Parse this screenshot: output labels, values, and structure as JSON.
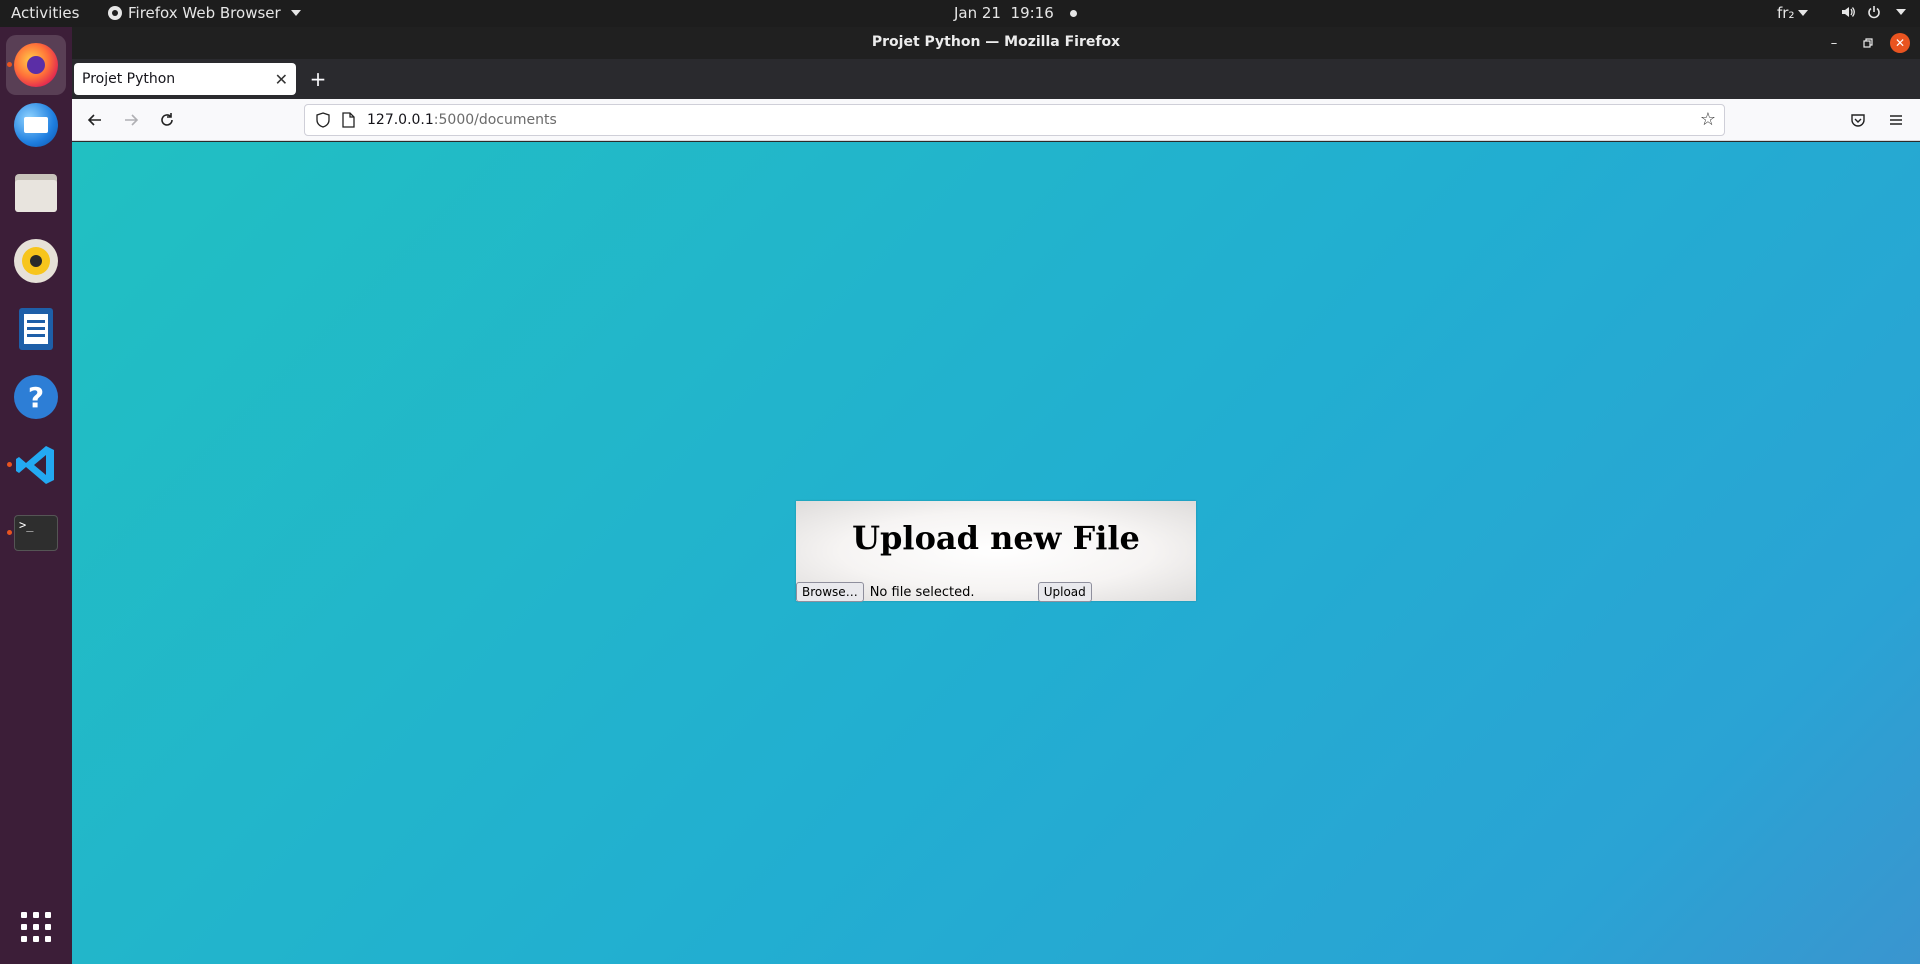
{
  "topbar": {
    "activities": "Activities",
    "app_name": "Firefox Web Browser",
    "date": "Jan 21",
    "time": "19:16",
    "keyboard_layout": "fr₂"
  },
  "dock": {
    "items": [
      {
        "name": "Firefox",
        "icon": "firefox-icon",
        "running": true,
        "active": true
      },
      {
        "name": "Thunderbird",
        "icon": "thunderbird-icon",
        "running": false
      },
      {
        "name": "Files",
        "icon": "files-icon",
        "running": false
      },
      {
        "name": "Rhythmbox",
        "icon": "rhythmbox-icon",
        "running": false
      },
      {
        "name": "LibreOffice Writer",
        "icon": "writer-icon",
        "running": false
      },
      {
        "name": "Help",
        "icon": "help-icon",
        "running": false,
        "glyph": "?"
      },
      {
        "name": "Visual Studio Code",
        "icon": "vscode-icon",
        "running": true
      },
      {
        "name": "Terminal",
        "icon": "terminal-icon",
        "running": true,
        "glyph": ">_"
      }
    ]
  },
  "window": {
    "title": "Projet Python — Mozilla Firefox",
    "tab_title": "Projet Python",
    "url_host": "127.0.0.1",
    "url_path": ":5000/documents"
  },
  "page": {
    "heading": "Upload new File",
    "browse_label": "Browse…",
    "file_status": "No file selected.",
    "upload_label": "Upload"
  },
  "colors": {
    "accent": "#e95420",
    "dock_bg": "#3c1e38",
    "topbar_bg": "#1d1d1d",
    "gradient_start": "#21c0c2",
    "gradient_end": "#3a95cf"
  }
}
